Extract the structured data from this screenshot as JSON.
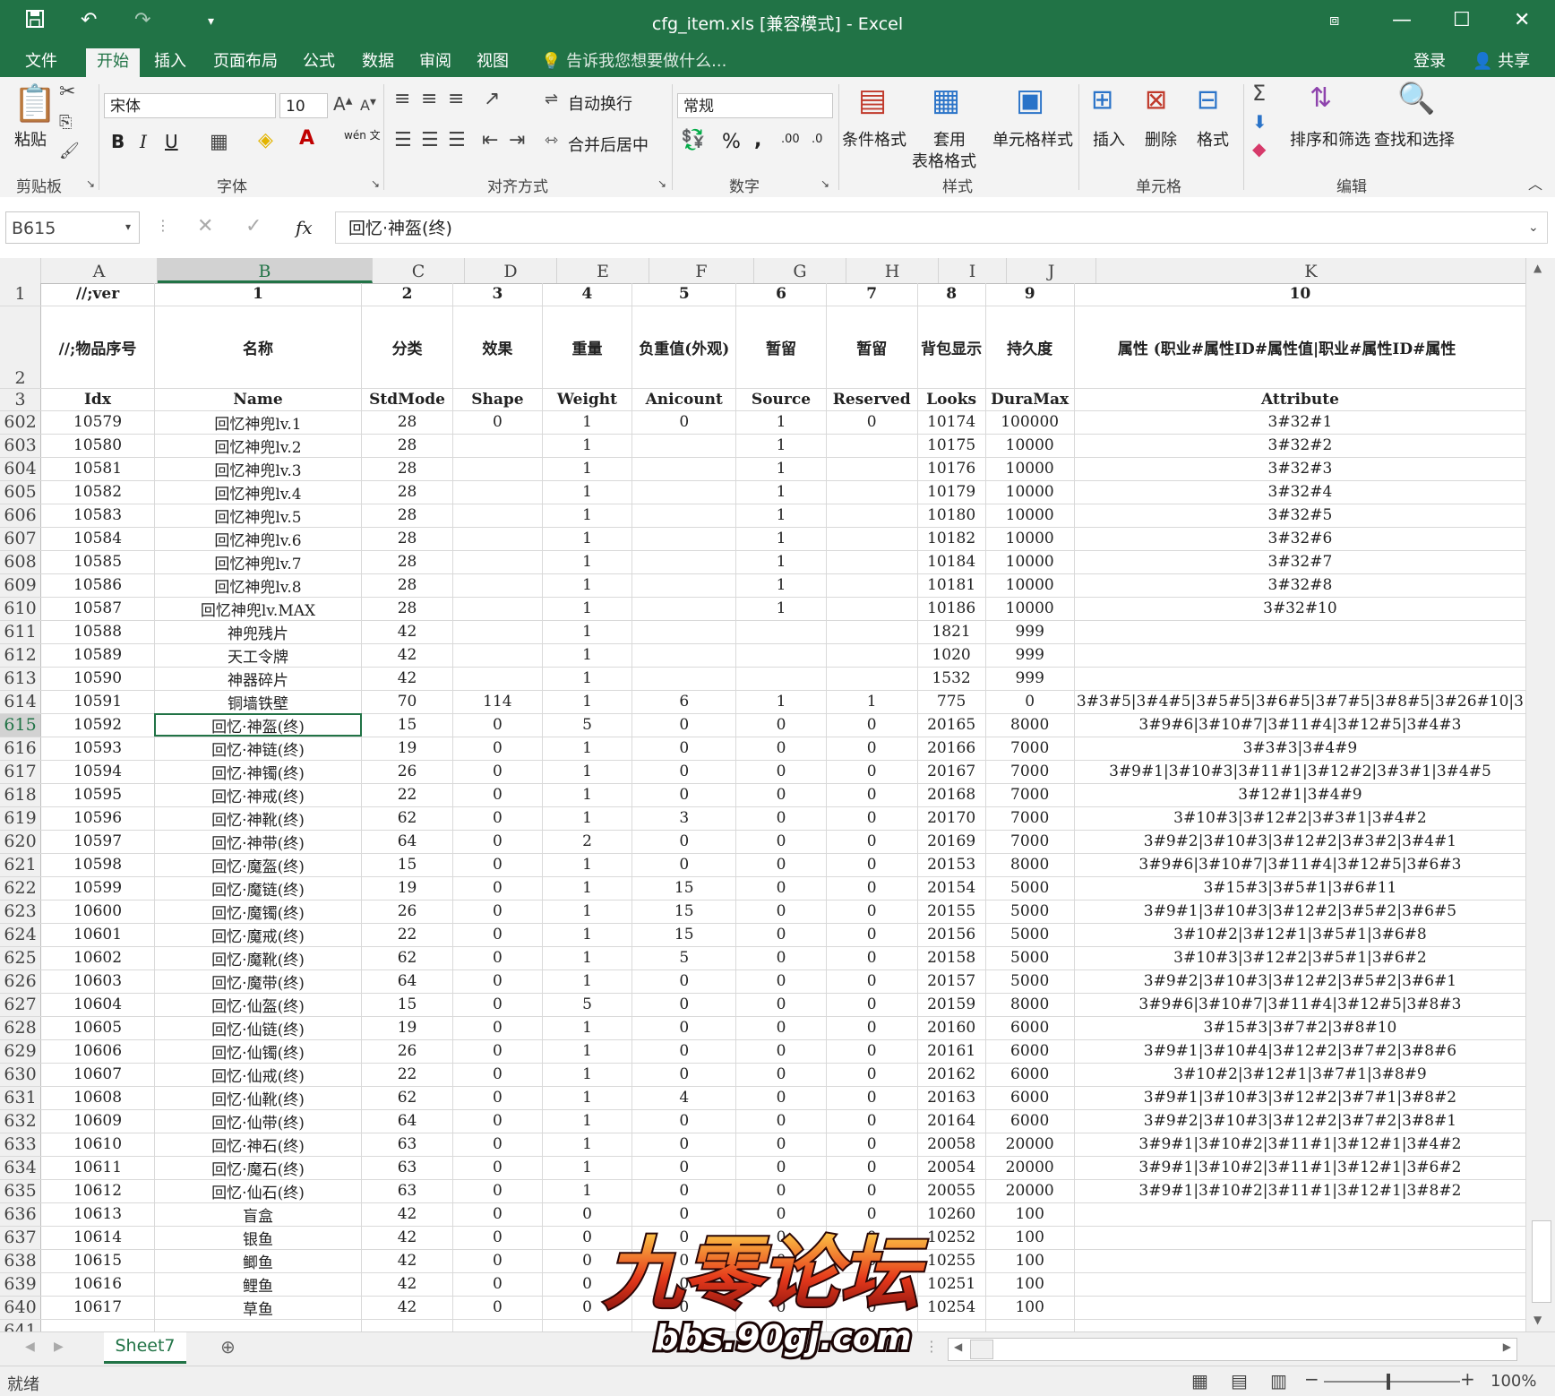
{
  "window": {
    "title": "cfg_item.xls  [兼容模式] - Excel"
  },
  "tabs": [
    "文件",
    "开始",
    "插入",
    "页面布局",
    "公式",
    "数据",
    "审阅",
    "视图"
  ],
  "tell_me": "告诉我您想要做什么...",
  "account": {
    "login": "登录",
    "share": "共享"
  },
  "ribbon": {
    "paste": "粘贴",
    "clipboard": "剪贴板",
    "font_name": "宋体",
    "font_size": "10",
    "font_group": "字体",
    "wrap_text": "自动换行",
    "merge_center": "合并后居中",
    "align_group": "对齐方式",
    "number_format": "常规",
    "number_group": "数字",
    "cond_format": "条件格式",
    "table_format_1": "套用",
    "table_format_2": "表格格式",
    "cell_style": "单元格样式",
    "styles_group": "样式",
    "insert": "插入",
    "delete": "删除",
    "format": "格式",
    "cells_group": "单元格",
    "sort_filter": "排序和筛选",
    "find_select": "查找和选择",
    "edit_group": "编辑",
    "phonetic": "wén 文",
    "bold": "B",
    "italic": "I",
    "underline": "U",
    "percent": "%",
    "comma": ",",
    "inc_decimal": ".00",
    "dec_decimal": ".0"
  },
  "formula_bar": {
    "name_box": "B615",
    "fx": "fx",
    "content": "回忆·神盔(终)"
  },
  "columns": [
    "A",
    "B",
    "C",
    "D",
    "E",
    "F",
    "G",
    "H",
    "I",
    "J",
    "K"
  ],
  "header_rows": [
    {
      "num": "1",
      "cells": [
        "//;ver",
        "1",
        "2",
        "3",
        "4",
        "5",
        "6",
        "7",
        "8",
        "9",
        "10"
      ]
    },
    {
      "num": "2",
      "cells": [
        "//;物品序号",
        "名称",
        "分类",
        "效果",
        "重量",
        "负重值(外观)",
        "暂留",
        "暂留",
        "背包显示",
        "持久度",
        "属性 (职业#属性ID#属性值|职业#属性ID#属性"
      ]
    },
    {
      "num": "3",
      "cells": [
        "Idx",
        "Name",
        "StdMode",
        "Shape",
        "Weight",
        "Anicount",
        "Source",
        "Reserved",
        "Looks",
        "DuraMax",
        "Attribute"
      ]
    }
  ],
  "rows": [
    {
      "num": "602",
      "cells": [
        "10579",
        "回忆神兜lv.1",
        "28",
        "0",
        "1",
        "0",
        "1",
        "0",
        "10174",
        "100000",
        "3#32#1"
      ]
    },
    {
      "num": "603",
      "cells": [
        "10580",
        "回忆神兜lv.2",
        "28",
        "",
        "1",
        "",
        "1",
        "",
        "10175",
        "10000",
        "3#32#2"
      ]
    },
    {
      "num": "604",
      "cells": [
        "10581",
        "回忆神兜lv.3",
        "28",
        "",
        "1",
        "",
        "1",
        "",
        "10176",
        "10000",
        "3#32#3"
      ]
    },
    {
      "num": "605",
      "cells": [
        "10582",
        "回忆神兜lv.4",
        "28",
        "",
        "1",
        "",
        "1",
        "",
        "10179",
        "10000",
        "3#32#4"
      ]
    },
    {
      "num": "606",
      "cells": [
        "10583",
        "回忆神兜lv.5",
        "28",
        "",
        "1",
        "",
        "1",
        "",
        "10180",
        "10000",
        "3#32#5"
      ]
    },
    {
      "num": "607",
      "cells": [
        "10584",
        "回忆神兜lv.6",
        "28",
        "",
        "1",
        "",
        "1",
        "",
        "10182",
        "10000",
        "3#32#6"
      ]
    },
    {
      "num": "608",
      "cells": [
        "10585",
        "回忆神兜lv.7",
        "28",
        "",
        "1",
        "",
        "1",
        "",
        "10184",
        "10000",
        "3#32#7"
      ]
    },
    {
      "num": "609",
      "cells": [
        "10586",
        "回忆神兜lv.8",
        "28",
        "",
        "1",
        "",
        "1",
        "",
        "10181",
        "10000",
        "3#32#8"
      ]
    },
    {
      "num": "610",
      "cells": [
        "10587",
        "回忆神兜lv.MAX",
        "28",
        "",
        "1",
        "",
        "1",
        "",
        "10186",
        "10000",
        "3#32#10"
      ]
    },
    {
      "num": "611",
      "cells": [
        "10588",
        "神兜残片",
        "42",
        "",
        "1",
        "",
        "",
        "",
        "1821",
        "999",
        ""
      ]
    },
    {
      "num": "612",
      "cells": [
        "10589",
        "天工令牌",
        "42",
        "",
        "1",
        "",
        "",
        "",
        "1020",
        "999",
        ""
      ]
    },
    {
      "num": "613",
      "cells": [
        "10590",
        "神器碎片",
        "42",
        "",
        "1",
        "",
        "",
        "",
        "1532",
        "999",
        ""
      ]
    },
    {
      "num": "614",
      "cells": [
        "10591",
        "铜墙铁壁",
        "70",
        "114",
        "1",
        "6",
        "1",
        "1",
        "775",
        "0",
        "3#3#5|3#4#5|3#5#5|3#6#5|3#7#5|3#8#5|3#26#10|3"
      ]
    },
    {
      "num": "615",
      "cells": [
        "10592",
        "回忆·神盔(终)",
        "15",
        "0",
        "5",
        "0",
        "0",
        "0",
        "20165",
        "8000",
        "3#9#6|3#10#7|3#11#4|3#12#5|3#4#3"
      ]
    },
    {
      "num": "616",
      "cells": [
        "10593",
        "回忆·神链(终)",
        "19",
        "0",
        "1",
        "0",
        "0",
        "0",
        "20166",
        "7000",
        "3#3#3|3#4#9"
      ]
    },
    {
      "num": "617",
      "cells": [
        "10594",
        "回忆·神镯(终)",
        "26",
        "0",
        "1",
        "0",
        "0",
        "0",
        "20167",
        "7000",
        "3#9#1|3#10#3|3#11#1|3#12#2|3#3#1|3#4#5"
      ]
    },
    {
      "num": "618",
      "cells": [
        "10595",
        "回忆·神戒(终)",
        "22",
        "0",
        "1",
        "0",
        "0",
        "0",
        "20168",
        "7000",
        "3#12#1|3#4#9"
      ]
    },
    {
      "num": "619",
      "cells": [
        "10596",
        "回忆·神靴(终)",
        "62",
        "0",
        "1",
        "3",
        "0",
        "0",
        "20170",
        "7000",
        "3#10#3|3#12#2|3#3#1|3#4#2"
      ]
    },
    {
      "num": "620",
      "cells": [
        "10597",
        "回忆·神带(终)",
        "64",
        "0",
        "2",
        "0",
        "0",
        "0",
        "20169",
        "7000",
        "3#9#2|3#10#3|3#12#2|3#3#2|3#4#1"
      ]
    },
    {
      "num": "621",
      "cells": [
        "10598",
        "回忆·魔盔(终)",
        "15",
        "0",
        "1",
        "0",
        "0",
        "0",
        "20153",
        "8000",
        "3#9#6|3#10#7|3#11#4|3#12#5|3#6#3"
      ]
    },
    {
      "num": "622",
      "cells": [
        "10599",
        "回忆·魔链(终)",
        "19",
        "0",
        "1",
        "15",
        "0",
        "0",
        "20154",
        "5000",
        "3#15#3|3#5#1|3#6#11"
      ]
    },
    {
      "num": "623",
      "cells": [
        "10600",
        "回忆·魔镯(终)",
        "26",
        "0",
        "1",
        "15",
        "0",
        "0",
        "20155",
        "5000",
        "3#9#1|3#10#3|3#12#2|3#5#2|3#6#5"
      ]
    },
    {
      "num": "624",
      "cells": [
        "10601",
        "回忆·魔戒(终)",
        "22",
        "0",
        "1",
        "15",
        "0",
        "0",
        "20156",
        "5000",
        "3#10#2|3#12#1|3#5#1|3#6#8"
      ]
    },
    {
      "num": "625",
      "cells": [
        "10602",
        "回忆·魔靴(终)",
        "62",
        "0",
        "1",
        "5",
        "0",
        "0",
        "20158",
        "5000",
        "3#10#3|3#12#2|3#5#1|3#6#2"
      ]
    },
    {
      "num": "626",
      "cells": [
        "10603",
        "回忆·魔带(终)",
        "64",
        "0",
        "1",
        "0",
        "0",
        "0",
        "20157",
        "5000",
        "3#9#2|3#10#3|3#12#2|3#5#2|3#6#1"
      ]
    },
    {
      "num": "627",
      "cells": [
        "10604",
        "回忆·仙盔(终)",
        "15",
        "0",
        "5",
        "0",
        "0",
        "0",
        "20159",
        "8000",
        "3#9#6|3#10#7|3#11#4|3#12#5|3#8#3"
      ]
    },
    {
      "num": "628",
      "cells": [
        "10605",
        "回忆·仙链(终)",
        "19",
        "0",
        "1",
        "0",
        "0",
        "0",
        "20160",
        "6000",
        "3#15#3|3#7#2|3#8#10"
      ]
    },
    {
      "num": "629",
      "cells": [
        "10606",
        "回忆·仙镯(终)",
        "26",
        "0",
        "1",
        "0",
        "0",
        "0",
        "20161",
        "6000",
        "3#9#1|3#10#4|3#12#2|3#7#2|3#8#6"
      ]
    },
    {
      "num": "630",
      "cells": [
        "10607",
        "回忆·仙戒(终)",
        "22",
        "0",
        "1",
        "0",
        "0",
        "0",
        "20162",
        "6000",
        "3#10#2|3#12#1|3#7#1|3#8#9"
      ]
    },
    {
      "num": "631",
      "cells": [
        "10608",
        "回忆·仙靴(终)",
        "62",
        "0",
        "1",
        "4",
        "0",
        "0",
        "20163",
        "6000",
        "3#9#1|3#10#3|3#12#2|3#7#1|3#8#2"
      ]
    },
    {
      "num": "632",
      "cells": [
        "10609",
        "回忆·仙带(终)",
        "64",
        "0",
        "1",
        "0",
        "0",
        "0",
        "20164",
        "6000",
        "3#9#2|3#10#3|3#12#2|3#7#2|3#8#1"
      ]
    },
    {
      "num": "633",
      "cells": [
        "10610",
        "回忆·神石(终)",
        "63",
        "0",
        "1",
        "0",
        "0",
        "0",
        "20058",
        "20000",
        "3#9#1|3#10#2|3#11#1|3#12#1|3#4#2"
      ]
    },
    {
      "num": "634",
      "cells": [
        "10611",
        "回忆·魔石(终)",
        "63",
        "0",
        "1",
        "0",
        "0",
        "0",
        "20054",
        "20000",
        "3#9#1|3#10#2|3#11#1|3#12#1|3#6#2"
      ]
    },
    {
      "num": "635",
      "cells": [
        "10612",
        "回忆·仙石(终)",
        "63",
        "0",
        "1",
        "0",
        "0",
        "0",
        "20055",
        "20000",
        "3#9#1|3#10#2|3#11#1|3#12#1|3#8#2"
      ]
    },
    {
      "num": "636",
      "cells": [
        "10613",
        "盲盒",
        "42",
        "0",
        "0",
        "0",
        "0",
        "0",
        "10260",
        "100",
        ""
      ]
    },
    {
      "num": "637",
      "cells": [
        "10614",
        "银鱼",
        "42",
        "0",
        "0",
        "0",
        "0",
        "0",
        "10252",
        "100",
        ""
      ]
    },
    {
      "num": "638",
      "cells": [
        "10615",
        "鲫鱼",
        "42",
        "0",
        "0",
        "0",
        "0",
        "0",
        "10255",
        "100",
        ""
      ]
    },
    {
      "num": "639",
      "cells": [
        "10616",
        "鲤鱼",
        "42",
        "0",
        "0",
        "0",
        "0",
        "0",
        "10251",
        "100",
        ""
      ]
    },
    {
      "num": "640",
      "cells": [
        "10617",
        "草鱼",
        "42",
        "0",
        "0",
        "0",
        "0",
        "0",
        "10254",
        "100",
        ""
      ]
    },
    {
      "num": "641",
      "cells": [
        "",
        "",
        "",
        "",
        "",
        "",
        "",
        "",
        "",
        "",
        ""
      ]
    }
  ],
  "selected_cell": {
    "row": "615",
    "col": "B"
  },
  "sheet_tab": "Sheet7",
  "status": {
    "ready": "就绪",
    "zoom": "100%"
  },
  "watermark": {
    "title": "九零论坛",
    "url": "bbs.90gj.com"
  },
  "colors": {
    "accent": "#217346"
  }
}
